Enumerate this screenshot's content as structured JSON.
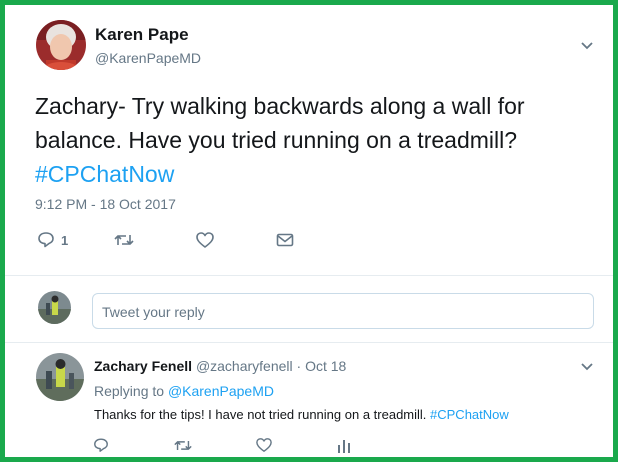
{
  "tweet": {
    "author_name": "Karen Pape",
    "author_handle": "@KarenPapeMD",
    "text_prefix": "Zachary- Try walking backwards along a wall for balance. Have you tried running on a treadmill? ",
    "hashtag": "#CPChatNow",
    "timestamp": "9:12 PM - 18 Oct 2017",
    "reply_count": "1",
    "icons": [
      "reply-icon",
      "retweet-icon",
      "like-icon",
      "message-icon",
      "chevron-down-icon"
    ]
  },
  "composer": {
    "placeholder": "Tweet your reply"
  },
  "reply": {
    "author_name": "Zachary Fenell",
    "author_handle": "@zacharyfenell",
    "separator": " · ",
    "date": "Oct 18",
    "replying_to_label": "Replying to ",
    "replying_to_handle": "@KarenPapeMD",
    "text_prefix": "Thanks for the tips! I have not tried running on a treadmill. ",
    "hashtag": "#CPChatNow",
    "icons": [
      "reply-icon",
      "retweet-icon",
      "like-icon",
      "analytics-icon",
      "chevron-down-icon"
    ]
  },
  "colors": {
    "frame_border": "#1aa94c",
    "link": "#1da1f2",
    "muted": "#657786"
  }
}
